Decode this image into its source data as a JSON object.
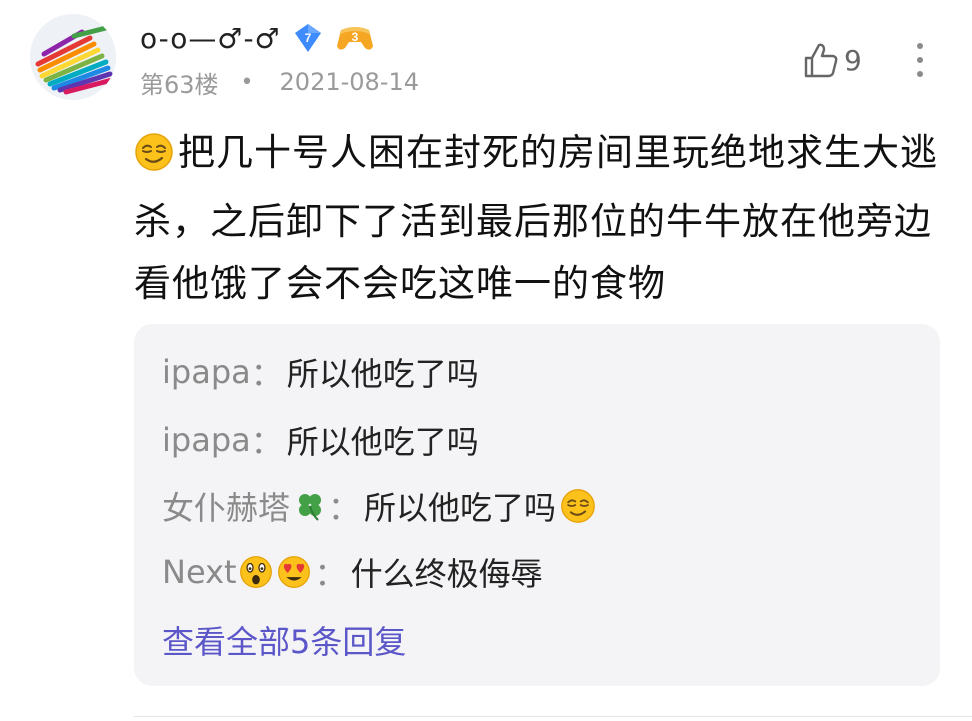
{
  "post": {
    "username": "o-o—♂-♂",
    "level_badge": "7",
    "fan_badge": "3",
    "floor": "第63楼",
    "separator": "•",
    "date": "2021-08-14",
    "like_count": "9",
    "content": "把几十号人困在封死的房间里玩绝地求生大逃杀，之后卸下了活到最后那位的牛牛放在他旁边看他饿了会不会吃这唯一的食物"
  },
  "replies": {
    "items": [
      {
        "author": "ipapa",
        "colon": "：",
        "text": "所以他吃了吗"
      },
      {
        "author": "ipapa",
        "colon": "：",
        "text": "所以他吃了吗"
      },
      {
        "author": "女仆赫塔",
        "colon": "：",
        "text": "所以他吃了吗"
      },
      {
        "author": "Next",
        "colon": "：",
        "text": "什么终极侮辱"
      }
    ],
    "view_all": "查看全部5条回复"
  },
  "icons": {
    "like": "thumbs-up-icon",
    "more": "more-vertical-icon",
    "clover": "four-leaf-clover-emoji",
    "smirk": "smirking-face-emoji",
    "shocked": "astonished-face-emoji",
    "heart_eyes": "heart-eyes-emoji"
  },
  "colors": {
    "link": "#5b57c9",
    "muted": "#8a8a8a",
    "reply_bg": "#f4f4f6",
    "level_badge": "#3d8bfd",
    "fan_badge": "#f5a623"
  }
}
